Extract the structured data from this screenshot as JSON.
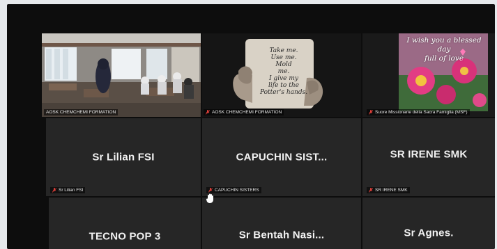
{
  "participants": [
    {
      "name_tag": "AOSK CHEMCHEMI FORMATION",
      "type": "video",
      "scene": "classroom",
      "active_speaker": true
    },
    {
      "name_tag": "AOSK CHEMCHEMI FORMATION",
      "type": "video",
      "scene": "potter-mug",
      "muted": true,
      "mug_lines": [
        "Take me.",
        "Use me.",
        "Mold",
        "me.",
        "I give my",
        "life to the",
        "Potter's hands."
      ]
    },
    {
      "name_tag": "Suore Missionarie della Sacra Famiglia (MSF)",
      "type": "video",
      "scene": "flowers",
      "muted": true,
      "caption_lines": [
        "I wish you a blessed day",
        "full of love"
      ]
    },
    {
      "display_name": "Sr Lilian FSI",
      "name_tag": "Sr Lilian FSI",
      "type": "avatar",
      "muted": true
    },
    {
      "display_name": "CAPUCHIN SIST...",
      "name_tag": "CAPUCHIN SISTERS",
      "type": "avatar",
      "muted": true
    },
    {
      "display_name": "SR IRENE SMK",
      "name_tag": "SR IRENE SMK",
      "type": "avatar",
      "muted": true
    },
    {
      "display_name": "TECNO POP 3",
      "type": "avatar"
    },
    {
      "display_name": "Sr Bentah Nasi...",
      "type": "avatar",
      "raised_hand": true
    },
    {
      "display_name": "Sr Agnes.",
      "type": "avatar"
    }
  ],
  "colors": {
    "active_border": "#d8ff66",
    "tile_bg": "#262626",
    "mic_muted": "#e0403a"
  },
  "icons": {
    "muted": "mic-muted-icon",
    "raise_hand": "raised-hand-icon"
  }
}
